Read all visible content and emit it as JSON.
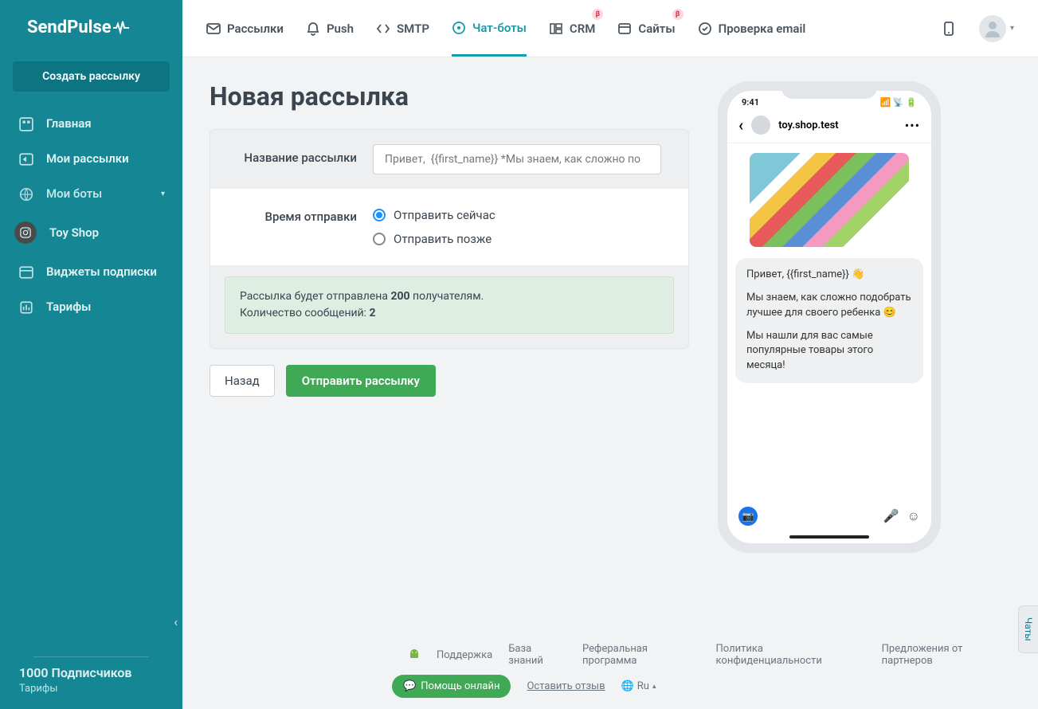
{
  "brand": "SendPulse",
  "sidebar": {
    "create_btn": "Создать рассылку",
    "items": [
      {
        "label": "Главная"
      },
      {
        "label": "Мои рассылки"
      },
      {
        "label": "Мои боты"
      },
      {
        "label": "Toy Shop"
      },
      {
        "label": "Виджеты подписки"
      },
      {
        "label": "Тарифы"
      }
    ],
    "subscribers": "1000 Подписчиков",
    "tariff": "Тарифы"
  },
  "topnav": {
    "items": [
      {
        "label": "Рассылки"
      },
      {
        "label": "Push"
      },
      {
        "label": "SMTP"
      },
      {
        "label": "Чат-боты"
      },
      {
        "label": "CRM",
        "badge": "β"
      },
      {
        "label": "Сайты",
        "badge": "β"
      },
      {
        "label": "Проверка email"
      }
    ]
  },
  "page": {
    "title": "Новая рассылка",
    "name_label": "Название рассылки",
    "name_value": "Привет,  {{first_name}} *Мы знаем, как сложно по",
    "time_label": "Время отправки",
    "radio_now": "Отправить сейчас",
    "radio_later": "Отправить позже",
    "info_l1_a": "Рассылка будет отправлена ",
    "info_l1_b": "200",
    "info_l1_c": " получателям.",
    "info_l2_a": "Количество сообщений: ",
    "info_l2_b": "2",
    "back_btn": "Назад",
    "send_btn": "Отправить рассылку"
  },
  "preview": {
    "time": "9:41",
    "account": "toy.shop.test",
    "msg_p1": "Привет,  {{first_name}} 👋",
    "msg_p2": "Мы знаем, как сложно подобрать лучшее для своего ребенка 😊",
    "msg_p3": "Мы нашли для вас самые популярные товары этого месяца!"
  },
  "footer": {
    "links": [
      "Поддержка",
      "База знаний",
      "Реферальная программа",
      "Политика конфиденциальности",
      "Предложения от партнеров"
    ],
    "help": "Помощь онлайн",
    "review": "Оставить отзыв",
    "lang": "Ru"
  },
  "chats_tab": "Чаты"
}
